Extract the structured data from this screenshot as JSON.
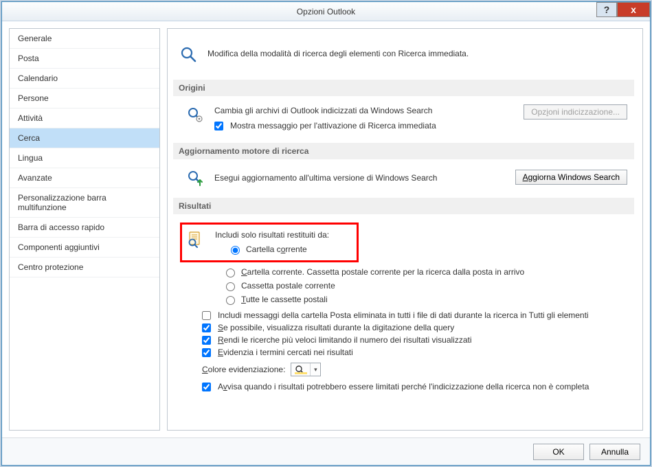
{
  "title": "Opzioni Outlook",
  "titlebar": {
    "help": "?",
    "close": "x"
  },
  "sidebar": {
    "items": [
      {
        "label": "Generale"
      },
      {
        "label": "Posta"
      },
      {
        "label": "Calendario"
      },
      {
        "label": "Persone"
      },
      {
        "label": "Attività"
      },
      {
        "label": "Cerca",
        "selected": true
      },
      {
        "label": "Lingua"
      },
      {
        "label": "Avanzate"
      },
      {
        "label": "Personalizzazione barra multifunzione"
      },
      {
        "label": "Barra di accesso rapido"
      },
      {
        "label": "Componenti aggiuntivi"
      },
      {
        "label": "Centro protezione"
      }
    ]
  },
  "intro": "Modifica della modalità di ricerca degli elementi con Ricerca immediata.",
  "sections": {
    "origini": {
      "header": "Origini",
      "line": "Cambia gli archivi di Outlook indicizzati da Windows Search",
      "check": "Mostra messaggio per l'attivazione di Ricerca immediata",
      "btn": "Opzioni indicizzazione...",
      "btn_ul": "i"
    },
    "agg": {
      "header": "Aggiornamento motore di ricerca",
      "line": "Esegui aggiornamento all'ultima versione di Windows Search",
      "btn": "Aggiorna Windows Search",
      "btn_ul": "A"
    },
    "risultati": {
      "header": "Risultati",
      "include_label": "Includi solo risultati restituiti da:",
      "radios": [
        {
          "label": "Cartella corrente",
          "ul": "o",
          "checked": true
        },
        {
          "label": "Cartella corrente. Cassetta postale corrente per la ricerca dalla posta in arrivo",
          "ul": "C"
        },
        {
          "label": "Cassetta postale corrente",
          "ul": null
        },
        {
          "label": "Tutte le cassette postali",
          "ul": "T"
        }
      ],
      "checks": [
        {
          "label": "Includi messaggi della cartella Posta eliminata in tutti i file di dati durante la ricerca in Tutti gli elementi",
          "checked": false,
          "ul": null
        },
        {
          "label": "Se possibile, visualizza risultati durante la digitazione della query",
          "checked": true,
          "ul": "S"
        },
        {
          "label": "Rendi le ricerche più veloci limitando il numero dei risultati visualizzati",
          "checked": true,
          "ul": "R"
        },
        {
          "label": "Evidenzia i termini cercati nei risultati",
          "checked": true,
          "ul": "E"
        }
      ],
      "color_label": "Colore evidenziazione:",
      "color_ul": "C",
      "warn_check": {
        "label": "Avvisa quando i risultati potrebbero essere limitati perché l'indicizzazione della ricerca non è completa",
        "checked": true,
        "ul": "v"
      }
    }
  },
  "footer": {
    "ok": "OK",
    "cancel": "Annulla"
  }
}
